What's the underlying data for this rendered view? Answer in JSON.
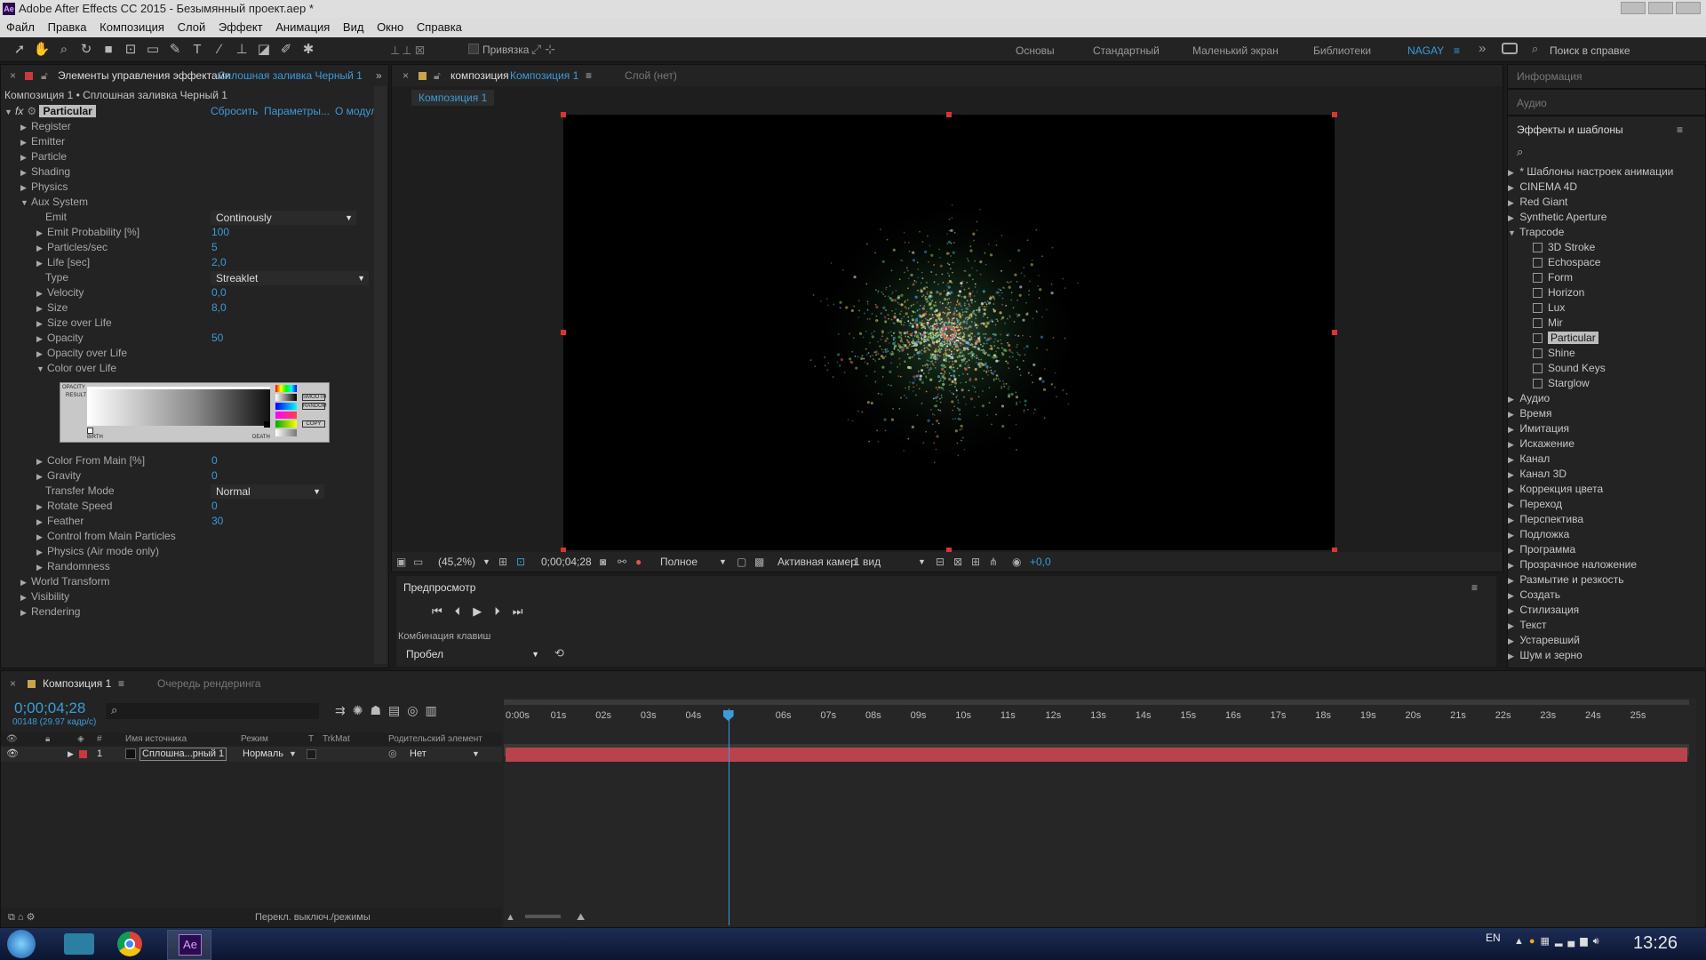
{
  "app": {
    "title": "Adobe After Effects CC 2015 - Безымянный проект.aep *",
    "logo": "Ae"
  },
  "menu": [
    "Файл",
    "Правка",
    "Композиция",
    "Слой",
    "Эффект",
    "Анимация",
    "Вид",
    "Окно",
    "Справка"
  ],
  "toolbar": {
    "snap_label": "Привязка",
    "workspaces": [
      "Основы",
      "Стандартный",
      "Маленький экран",
      "Библиотеки",
      "NAGAY"
    ],
    "active_workspace": "NAGAY",
    "search_placeholder": "Поиск в справке"
  },
  "effect_controls": {
    "tab_label": "Элементы управления эффектами",
    "tab_layer": "Сплошная заливка Черный 1",
    "breadcrumb": "Композиция 1 • Сплошная заливка Черный 1",
    "effect_name": "Particular",
    "reset": "Сбросить",
    "params": "Параметры...",
    "about": "О модул",
    "groups": [
      "Register",
      "Emitter",
      "Particle",
      "Shading",
      "Physics"
    ],
    "aux": "Aux System",
    "props": [
      {
        "label": "Emit",
        "value": "Continously",
        "type": "dropdown"
      },
      {
        "label": "Emit Probability [%]",
        "value": "100"
      },
      {
        "label": "Particles/sec",
        "value": "5"
      },
      {
        "label": "Life [sec]",
        "value": "2,0"
      },
      {
        "label": "Type",
        "value": "Streaklet",
        "type": "dropdown"
      },
      {
        "label": "Velocity",
        "value": "0,0"
      },
      {
        "label": "Size",
        "value": "8,0"
      },
      {
        "label": "Size over Life",
        "value": ""
      },
      {
        "label": "Opacity",
        "value": "50"
      },
      {
        "label": "Opacity over Life",
        "value": ""
      },
      {
        "label": "Color over Life",
        "value": "",
        "expanded": true
      }
    ],
    "props2": [
      {
        "label": "Color From Main [%]",
        "value": "0"
      },
      {
        "label": "Gravity",
        "value": "0"
      },
      {
        "label": "Transfer Mode",
        "value": "Normal",
        "type": "dropdown"
      },
      {
        "label": "Rotate Speed",
        "value": "0"
      },
      {
        "label": "Feather",
        "value": "30"
      },
      {
        "label": "Control from Main Particles",
        "value": ""
      },
      {
        "label": "Physics (Air mode only)",
        "value": ""
      },
      {
        "label": "Randomness",
        "value": ""
      }
    ],
    "tail": [
      "World Transform",
      "Visibility",
      "Rendering"
    ],
    "graph": {
      "opacity": "OPACITY",
      "result": "RESULT",
      "birth": "BIRTH",
      "death": "DEATH",
      "smooth": "SMOOTH",
      "random": "RANDOM",
      "copy": "COPY"
    }
  },
  "composition": {
    "tab_label": "композиция",
    "tab_name": "Композиция 1",
    "layer_tab": "Слой (нет)",
    "comp_button": "Композиция 1",
    "zoom": "(45,2%)",
    "timecode": "0;00;04;28",
    "quality": "Полное",
    "camera": "Активная камер",
    "views": "1 вид",
    "exposure": "+0,0"
  },
  "preview": {
    "title": "Предпросмотр",
    "shortcut_label": "Комбинация клавиш",
    "shortcut_value": "Пробел"
  },
  "right": {
    "info": "Информация",
    "audio": "Аудио",
    "effects_title": "Эффекты и шаблоны",
    "tree_top": [
      "* Шаблоны настроек анимации",
      "CINEMA 4D",
      "Red Giant",
      "Synthetic Aperture",
      "Trapcode"
    ],
    "trapcode": [
      "3D Stroke",
      "Echospace",
      "Form",
      "Horizon",
      "Lux",
      "Mir",
      "Particular",
      "Shine",
      "Sound Keys",
      "Starglow"
    ],
    "selected": "Particular",
    "tree_bottom": [
      "Аудио",
      "Время",
      "Имитация",
      "Искажение",
      "Канал",
      "Канал 3D",
      "Коррекция цвета",
      "Переход",
      "Перспектива",
      "Подложка",
      "Программа",
      "Прозрачное наложение",
      "Размытие и резкость",
      "Создать",
      "Стилизация",
      "Текст",
      "Устаревший",
      "Шум и зерно"
    ]
  },
  "timeline": {
    "tab": "Композиция 1",
    "render_tab": "Очередь рендеринга",
    "timecode": "0;00;04;28",
    "frames": "00148 (29.97 кадр/с)",
    "columns": {
      "source": "Имя источника",
      "mode": "Режим",
      "t": "T",
      "trkmat": "TrkMat",
      "parent": "Родительский элемент"
    },
    "layer": {
      "num": "1",
      "name": "Сплошна...рный 1",
      "mode": "Нормаль",
      "parent": "Нет"
    },
    "ticks": [
      "0:00s",
      "01s",
      "02s",
      "03s",
      "04s",
      "",
      "06s",
      "07s",
      "08s",
      "09s",
      "10s",
      "11s",
      "12s",
      "13s",
      "14s",
      "15s",
      "16s",
      "17s",
      "18s",
      "19s",
      "20s",
      "21s",
      "22s",
      "23s",
      "24s",
      "25s"
    ],
    "current_time": 4.95,
    "bottom_label": "Перекл. выключ./режимы"
  },
  "taskbar": {
    "lang": "EN",
    "clock": "13:26",
    "ae_label": "Ae"
  }
}
